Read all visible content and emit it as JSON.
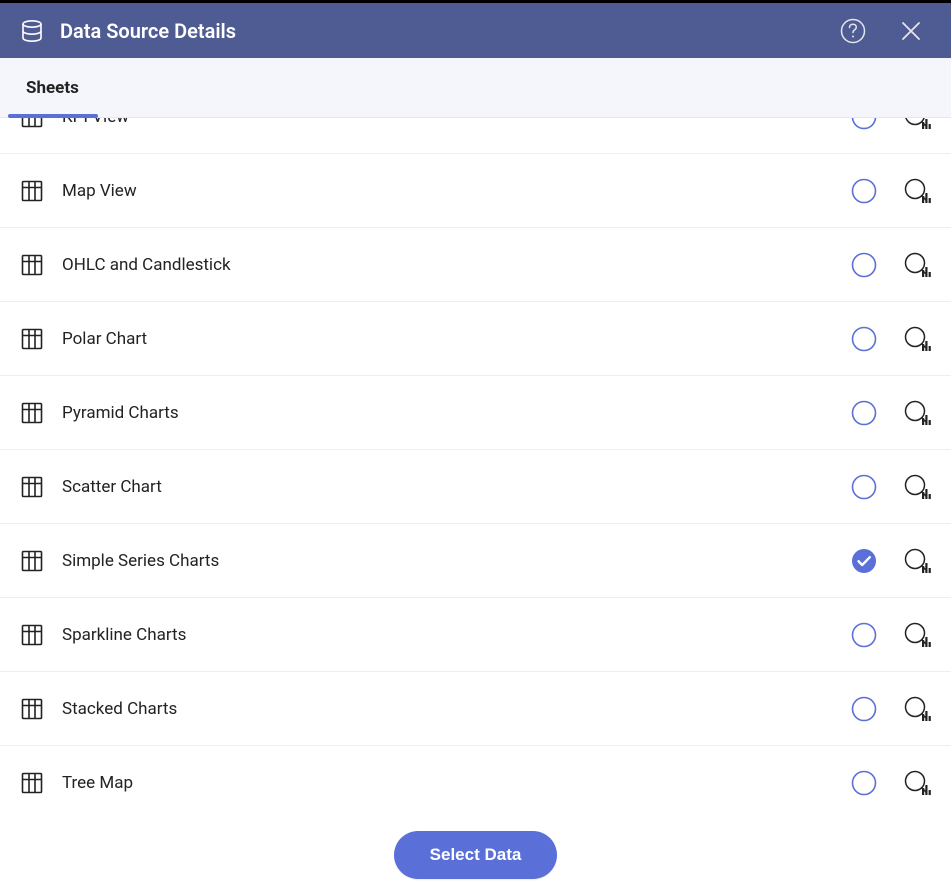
{
  "header": {
    "title": "Data Source Details"
  },
  "tabs": {
    "active": "Sheets"
  },
  "sheets": [
    {
      "label": "KPI View",
      "selected": false
    },
    {
      "label": "Map View",
      "selected": false
    },
    {
      "label": "OHLC and Candlestick",
      "selected": false
    },
    {
      "label": "Polar Chart",
      "selected": false
    },
    {
      "label": "Pyramid Charts",
      "selected": false
    },
    {
      "label": "Scatter Chart",
      "selected": false
    },
    {
      "label": "Simple Series Charts",
      "selected": true
    },
    {
      "label": "Sparkline Charts",
      "selected": false
    },
    {
      "label": "Stacked Charts",
      "selected": false
    },
    {
      "label": "Tree Map",
      "selected": false
    }
  ],
  "footer": {
    "select_label": "Select Data"
  }
}
